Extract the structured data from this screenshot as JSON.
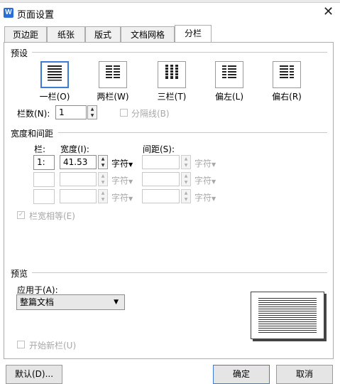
{
  "window": {
    "title": "页面设置"
  },
  "tabs": [
    {
      "label": "页边距"
    },
    {
      "label": "纸张"
    },
    {
      "label": "版式"
    },
    {
      "label": "文档网格"
    },
    {
      "label": "分栏",
      "active": true
    }
  ],
  "preset": {
    "heading": "预设",
    "options": [
      {
        "label": "一栏(O)",
        "icon": "one-column-icon",
        "selected": true
      },
      {
        "label": "两栏(W)",
        "icon": "two-columns-icon"
      },
      {
        "label": "三栏(T)",
        "icon": "three-columns-icon"
      },
      {
        "label": "偏左(L)",
        "icon": "left-column-icon"
      },
      {
        "label": "偏右(R)",
        "icon": "right-column-icon"
      }
    ],
    "column_count_label": "栏数(N):",
    "column_count_value": "1",
    "separator_label": "分隔线(B)"
  },
  "width_spacing": {
    "heading": "宽度和间距",
    "col_header": "栏:",
    "width_header": "宽度(I):",
    "spacing_header": "间距(S):",
    "rows": [
      {
        "col": "1:",
        "width": "41.53",
        "width_unit": "字符",
        "spacing": "",
        "spacing_unit": "字符",
        "enabled": true
      },
      {
        "col": "",
        "width": "",
        "width_unit": "字符",
        "spacing": "",
        "spacing_unit": "字符",
        "enabled": false
      },
      {
        "col": "",
        "width": "",
        "width_unit": "字符",
        "spacing": "",
        "spacing_unit": "字符",
        "enabled": false
      }
    ],
    "equal_width_label": "栏宽相等(E)"
  },
  "preview": {
    "heading": "预览",
    "apply_to_label": "应用于(A):",
    "apply_to_value": "整篇文档",
    "new_column_label": "开始新栏(U)"
  },
  "buttons": {
    "default": "默认(D)...",
    "ok": "确定",
    "cancel": "取消"
  },
  "colors": {
    "accent": "#3c7bd8",
    "app_icon": "#2b6fd6"
  }
}
